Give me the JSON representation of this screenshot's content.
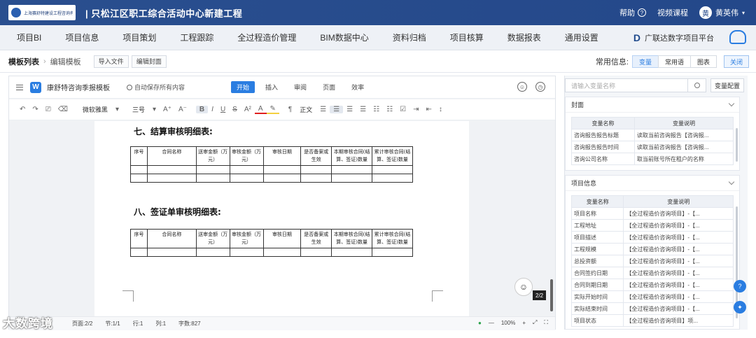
{
  "header": {
    "logo_text": "上海赛舒特建设工程咨询有限公司",
    "project_title": "| 只松江区职工综合活动中心新建工程",
    "help": "帮助",
    "video": "视频课程",
    "user_name": "黄英伟",
    "avatar_char": "黄"
  },
  "nav": {
    "items": [
      "项目BI",
      "项目信息",
      "项目策划",
      "工程跟踪",
      "全过程造价管理",
      "BIM数据中心",
      "资料归档",
      "项目核算",
      "数据报表",
      "通用设置"
    ],
    "platform": "广联达数字项目平台"
  },
  "template_bar": {
    "crumb_root": "模板列表",
    "crumb_current": "编辑模板",
    "import_btn": "导入文件",
    "cover_btn": "编辑封面",
    "common_label": "常用信息:",
    "segs": [
      "变量",
      "常用语",
      "图表"
    ],
    "close": "关闭"
  },
  "editor": {
    "doc_name": "康舒特咨询季报模板",
    "autosave": "自动保存所有内容",
    "tabs": [
      "开始",
      "插入",
      "审阅",
      "页面",
      "效率"
    ],
    "font_family": "微软雅黑",
    "font_size": "三号",
    "paragraph": "正文",
    "section7_title": "七、结算审核明细表:",
    "section8_title": "八、签证单审核明细表:",
    "table7_headers": [
      "序号",
      "合同名称",
      "送审金额（万元）",
      "审核金额（万元）",
      "审核日期",
      "是否备案或生效",
      "本期审核合同(结算、签证)数量",
      "累计审核合同(结算、签证)数量"
    ],
    "table8_headers": [
      "序号",
      "合同名称",
      "送审金额（万元）",
      "审核金额（万元）",
      "审核日期",
      "是否备案或生效",
      "本期审核合同(结算、签证)数量",
      "累计审核合同(结算、签证)数量"
    ],
    "page_indicator": "2/2",
    "status": {
      "page": "页面:2/2",
      "section": "节:1/1",
      "row": "行:1",
      "col": "列:1",
      "words": "字数:827",
      "zoom": "100%"
    }
  },
  "right_panel": {
    "search_placeholder": "请输入变量名称",
    "config_btn": "变量配置",
    "cover_section": {
      "title": "封面",
      "headers": [
        "变量名称",
        "变量说明"
      ],
      "rows": [
        [
          "咨询报告报告标题",
          "读取当前咨询报告【咨询报..."
        ],
        [
          "咨询报告报告时间",
          "读取当前咨询报告【咨询报..."
        ],
        [
          "咨询公司名称",
          "取当前账号所在租户的名称"
        ]
      ]
    },
    "project_section": {
      "title": "项目信息",
      "headers": [
        "变量名称",
        "变量说明"
      ],
      "rows": [
        [
          "项目名称",
          "【全过程造价咨询项目】-【..."
        ],
        [
          "工程地址",
          "【全过程造价咨询项目】-【..."
        ],
        [
          "项目描述",
          "【全过程造价咨询项目】-【..."
        ],
        [
          "工程规模",
          "【全过程造价咨询项目】-【..."
        ],
        [
          "总投资额",
          "【全过程造价咨询项目】-【..."
        ],
        [
          "合同签约日期",
          "【全过程造价咨询项目】-【..."
        ],
        [
          "合同到期日期",
          "【全过程造价咨询项目】-【..."
        ],
        [
          "实际开始时间",
          "【全过程造价咨询项目】-【..."
        ],
        [
          "实际结束时间",
          "【全过程造价咨询项目】-【..."
        ],
        [
          "项目状态",
          "【全过程造价咨询项目】项..."
        ]
      ]
    }
  },
  "watermark": "大数跨境"
}
